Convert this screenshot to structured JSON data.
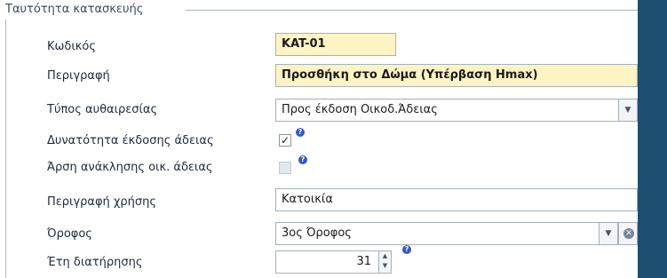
{
  "group": {
    "title": "Ταυτότητα κατασκευής"
  },
  "fields": {
    "code": {
      "label": "Κωδικός",
      "value": "KAT-01"
    },
    "description": {
      "label": "Περιγραφή",
      "value": "Προσθήκη στο Δώμα (Υπέρβαση Hmax)"
    },
    "violation_type": {
      "label": "Τύπος αυθαιρεσίας",
      "value": "Προς έκδοση Οικοδ.Άδειας"
    },
    "permit_possible": {
      "label": "Δυνατότητα έκδοσης άδειας",
      "checked": true
    },
    "revocation_lift": {
      "label": "Άρση ανάκλησης οικ. άδειας",
      "checked": false
    },
    "use_description": {
      "label": "Περιγραφή χρήσης",
      "value": "Κατοικία"
    },
    "floor": {
      "label": "Όροφος",
      "value": "3ος Όροφος"
    },
    "retention_years": {
      "label": "Έτη διατήρησης",
      "value": "31"
    }
  },
  "icons": {
    "help": "help-icon",
    "dropdown": "chevron-down-icon",
    "clear": "clear-icon",
    "spinner": "spinner-arrows-icon",
    "check": "checkmark-icon"
  },
  "colors": {
    "required_field_bg": "#fdf4c6",
    "frame_blue": "#1e4f73",
    "help_blue": "#3558c8"
  }
}
